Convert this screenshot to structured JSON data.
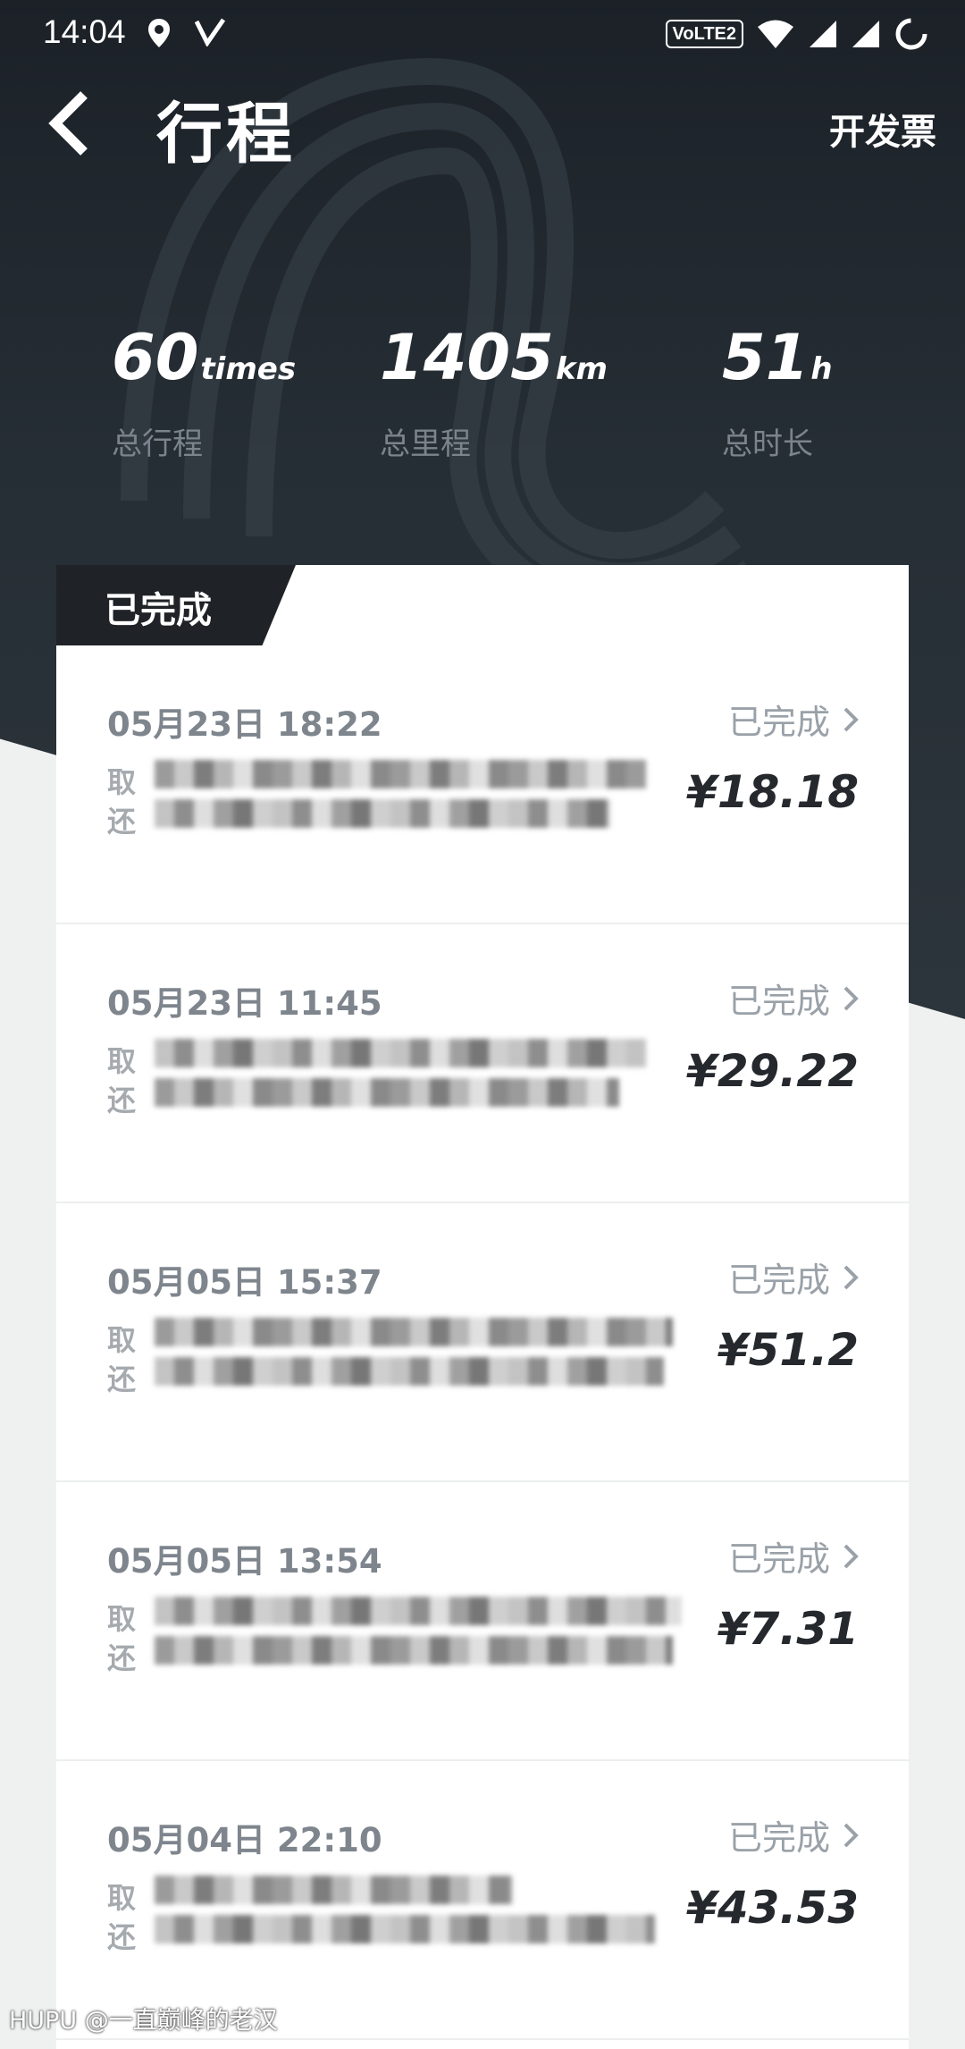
{
  "status_bar": {
    "time": "14:04",
    "network_badge": "VoLTE2",
    "icons": [
      "location-icon",
      "nfc-icon",
      "wifi-icon",
      "signal-icon",
      "signal-icon",
      "loading-icon"
    ]
  },
  "header": {
    "back_icon": "chevron-left-icon",
    "title": "行程",
    "invoice_label": "开发票"
  },
  "stats": [
    {
      "value": "60",
      "unit": "times",
      "label": "总行程"
    },
    {
      "value": "1405",
      "unit": "km",
      "label": "总里程"
    },
    {
      "value": "51",
      "unit": "h",
      "label": "总时长"
    }
  ],
  "section": {
    "tab_label": "已完成"
  },
  "trips": [
    {
      "datetime": "05月23日 18:22",
      "status": "已完成",
      "pickup_label": "取",
      "return_label": "还",
      "price": "¥18.18"
    },
    {
      "datetime": "05月23日 11:45",
      "status": "已完成",
      "pickup_label": "取",
      "return_label": "还",
      "price": "¥29.22"
    },
    {
      "datetime": "05月05日 15:37",
      "status": "已完成",
      "pickup_label": "取",
      "return_label": "还",
      "price": "¥51.2"
    },
    {
      "datetime": "05月05日 13:54",
      "status": "已完成",
      "pickup_label": "取",
      "return_label": "还",
      "price": "¥7.31"
    },
    {
      "datetime": "05月04日 22:10",
      "status": "已完成",
      "pickup_label": "取",
      "return_label": "还",
      "price": "¥43.53"
    }
  ],
  "watermark": "HUPU @一直巅峰的老汉",
  "colors": {
    "hero_bg": "#1b2127",
    "card_bg": "#ffffff",
    "tab_bg": "#1f2226",
    "price_text": "#25292d"
  }
}
